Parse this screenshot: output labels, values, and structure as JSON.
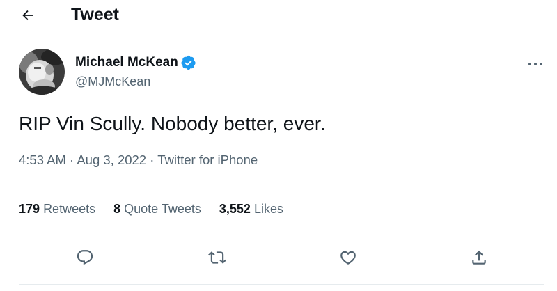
{
  "header": {
    "title": "Tweet",
    "back_icon": "arrow-left-icon"
  },
  "author": {
    "display_name": "Michael McKean",
    "handle": "@MJMcKean",
    "verified_icon": "verified-badge-icon",
    "more_icon": "more-horizontal-icon"
  },
  "tweet": {
    "text": "RIP Vin Scully. Nobody better, ever.",
    "time": "4:53 AM",
    "date": "Aug 3, 2022",
    "source": "Twitter for iPhone",
    "separator": " · "
  },
  "stats": {
    "retweets": {
      "count": "179",
      "label": "Retweets"
    },
    "quotes": {
      "count": "8",
      "label": "Quote Tweets"
    },
    "likes": {
      "count": "3,552",
      "label": "Likes"
    }
  },
  "actions": {
    "reply_icon": "reply-icon",
    "retweet_icon": "retweet-icon",
    "like_icon": "heart-icon",
    "share_icon": "share-icon"
  },
  "colors": {
    "text": "#0f1419",
    "secondary": "#536471",
    "accent": "#1d9bf0",
    "divider": "#e6ebee"
  }
}
